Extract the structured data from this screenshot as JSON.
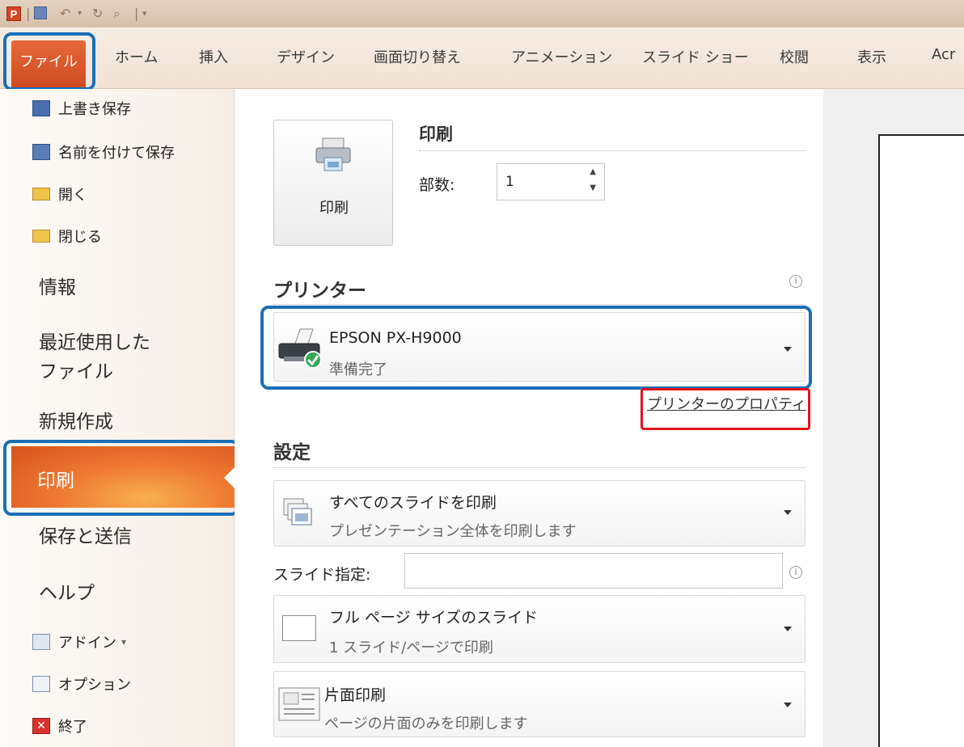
{
  "colors": {
    "accent": "#d24625",
    "highlight_blue": "#1a6fb5",
    "highlight_red": "#e0141e",
    "selected_nav": "#ee7a33"
  },
  "qat": {
    "logo": "P",
    "icons": [
      "save-icon",
      "undo-icon",
      "redo-icon",
      "print-preview-icon",
      "customize-icon"
    ]
  },
  "ribbon": {
    "file_tab": "ファイル",
    "tabs": [
      "ホーム",
      "挿入",
      "デザイン",
      "画面切り替え",
      "アニメーション",
      "スライド ショー",
      "校閲",
      "表示",
      "Acr"
    ]
  },
  "nav": {
    "commands_top": [
      "上書き保存",
      "名前を付けて保存",
      "開く",
      "閉じる"
    ],
    "info": "情報",
    "recent_line1": "最近使用した",
    "recent_line2": "ファイル",
    "new": "新規作成",
    "print": "印刷",
    "save_send": "保存と送信",
    "help": "ヘルプ",
    "commands_bottom": [
      "アドイン",
      "オプション",
      "終了"
    ],
    "addin_arrow": "▾"
  },
  "print": {
    "button_label": "印刷",
    "heading": "印刷",
    "copies_label": "部数:",
    "copies_value": "1"
  },
  "printer": {
    "heading": "プリンター",
    "name": "EPSON PX-H9000",
    "status": "準備完了",
    "properties_link": "プリンターのプロパティ"
  },
  "settings": {
    "heading": "設定",
    "slides_title": "すべてのスライドを印刷",
    "slides_sub": "プレゼンテーション全体を印刷します",
    "slide_spec_label": "スライド指定:",
    "slide_spec_value": "",
    "layout_title": "フル ページ サイズのスライド",
    "layout_sub": "1 スライド/ページで印刷",
    "sides_title": "片面印刷",
    "sides_sub": "ページの片面のみを印刷します"
  }
}
